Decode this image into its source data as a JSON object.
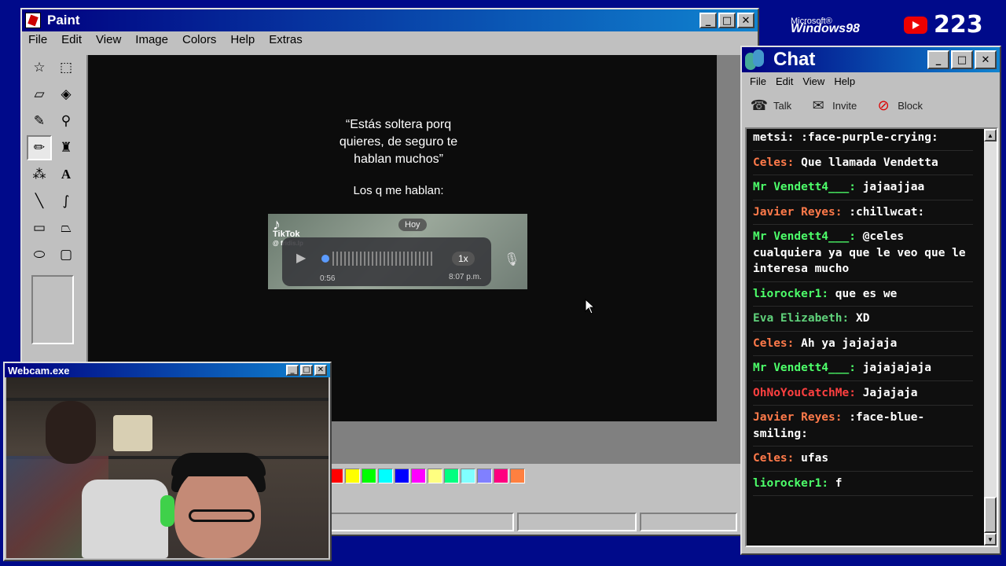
{
  "paint": {
    "title": "Paint",
    "menu": [
      "File",
      "Edit",
      "View",
      "Image",
      "Colors",
      "Help",
      "Extras"
    ],
    "canvas": {
      "quote": "“Estás soltera porq quieres, de seguro te hablan muchos”",
      "caption": "Los q me hablan:",
      "tiktok": {
        "brand": "TikTok",
        "handle": "@ fridis.lp",
        "date_chip": "Hoy",
        "speed": "1x",
        "duration": "0:56",
        "time": "8:07 p.m."
      }
    },
    "palette": [
      "#ff0000",
      "#ffff00",
      "#00ff00",
      "#00ffff",
      "#0000ff",
      "#ff00ff",
      "#ffff80",
      "#00ff80",
      "#80ffff",
      "#8080ff",
      "#ff0080",
      "#ff8040"
    ]
  },
  "webcam": {
    "title": "Webcam.exe"
  },
  "desktop": {
    "os_brand_small": "Microsoft®",
    "os_brand": "Windows98",
    "youtube_count": "223"
  },
  "chat": {
    "title": "Chat",
    "menu": [
      "File",
      "Edit",
      "View",
      "Help"
    ],
    "tools": [
      {
        "label": "Talk",
        "icon": "talk-icon"
      },
      {
        "label": "Invite",
        "icon": "invite-icon"
      },
      {
        "label": "Block",
        "icon": "block-icon"
      }
    ],
    "messages": [
      {
        "user": "metsi",
        "text": ":face-purple-crying:",
        "color": "#ffffff"
      },
      {
        "user": "Celes",
        "text": "Que llamada Vendetta",
        "color": "#ff7a4a"
      },
      {
        "user": "Mr Vendett4___",
        "text": "jajaajjaa",
        "color": "#4dff6a"
      },
      {
        "user": "Javier Reyes",
        "text": ":chillwcat:",
        "color": "#ff7a4a"
      },
      {
        "user": "Mr Vendett4___",
        "text": "@celes cualquiera ya que le veo que le interesa mucho",
        "color": "#4dff6a"
      },
      {
        "user": "liorocker1",
        "text": "que es we",
        "color": "#4dff6a"
      },
      {
        "user": "Eva Elizabeth",
        "text": "XD",
        "color": "#5fd07a"
      },
      {
        "user": "Celes",
        "text": "Ah ya jajajaja",
        "color": "#ff7a4a"
      },
      {
        "user": "Mr Vendett4___",
        "text": "jajajajaja",
        "color": "#4dff6a"
      },
      {
        "user": "OhNoYouCatchMe",
        "text": "Jajajaja",
        "color": "#ff4040"
      },
      {
        "user": "Javier Reyes",
        "text": ":face-blue-smiling:",
        "color": "#ff7a4a"
      },
      {
        "user": "Celes",
        "text": "ufas",
        "color": "#ff7a4a"
      },
      {
        "user": "liorocker1",
        "text": "f",
        "color": "#4dff6a"
      }
    ]
  }
}
